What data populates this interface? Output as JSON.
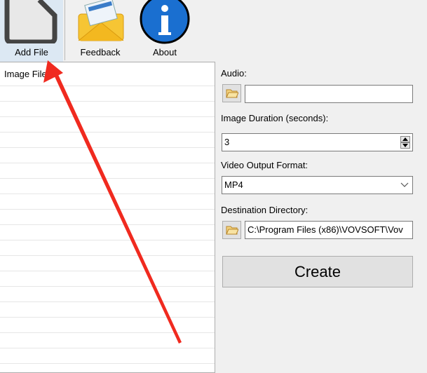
{
  "toolbar": {
    "add_file": "Add File",
    "feedback": "Feedback",
    "about": "About"
  },
  "list": {
    "header": "Image Files"
  },
  "form": {
    "audio_label": "Audio:",
    "audio_value": "",
    "duration_label": "Image Duration (seconds):",
    "duration_value": "3",
    "format_label": "Video Output Format:",
    "format_value": "MP4",
    "dest_label": "Destination Directory:",
    "dest_value": "C:\\Program Files (x86)\\VOVSOFT\\Vov",
    "create": "Create"
  },
  "annotation": {
    "arrow_color": "#f02a1f"
  }
}
